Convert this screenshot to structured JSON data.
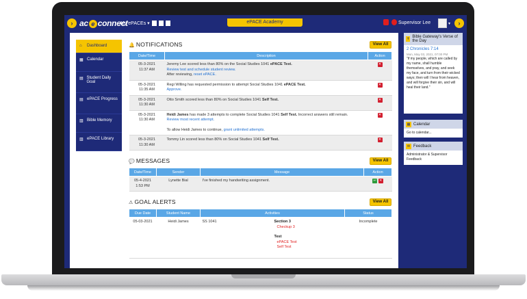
{
  "topbar": {
    "logo_text_pre": "ac",
    "logo_e": "e",
    "logo_text_post": "connect",
    "my_epaces": "My ePACEs",
    "academy_tab": "ePACE Academy",
    "user_name": "Supervisor Lee"
  },
  "sidebar": {
    "items": [
      {
        "label": "Dashboard",
        "icon": "home-icon"
      },
      {
        "label": "Calendar",
        "icon": "calendar-icon"
      },
      {
        "label": "Student Daily Goal",
        "icon": "goal-icon"
      },
      {
        "label": "ePACE Progress",
        "icon": "progress-icon"
      },
      {
        "label": "Bible Memory",
        "icon": "book-icon"
      },
      {
        "label": "ePACE Library",
        "icon": "library-icon"
      }
    ]
  },
  "notifications": {
    "title": "NOTIFICATIONS",
    "view_all": "View All",
    "headers": [
      "Date/Time",
      "Description",
      "Action"
    ],
    "rows": [
      {
        "date": "05-3-2021",
        "time": "11:37 AM",
        "name": "Jeremy Lee",
        "text": "scored less than 80% on the Social Studies 1041",
        "bold": "ePACE Test.",
        "link1": "Review test and schedule student review.",
        "line3_pre": "After reviewing,",
        "link2": "reset ePACE."
      },
      {
        "date": "05-3-2021",
        "time": "11:35 AM",
        "name": "Regi Willing",
        "text": "has requested permission to attempt Social Studies 1041",
        "bold": "ePACE Test.",
        "link1": "Approve."
      },
      {
        "date": "05-3-2021",
        "time": "11:30 AM",
        "name": "Otto Smith",
        "text": "scored less than 80% on Social Studies 1041",
        "bold": "Self Test."
      },
      {
        "date": "05-3-2021",
        "time": "11:30 AM",
        "name": "Heidi James",
        "text": "has made 3 attempts to complete Social Studies 1041",
        "bold": "Self Test.",
        "text2": "Incorrect answers still remain.",
        "link1": "Review most recent attempt.",
        "line3_pre": "To allow Heidi James to continue,",
        "link2": "grant unlimited attempts."
      },
      {
        "date": "05-3-2021",
        "time": "11:30 AM",
        "name": "Tommy Lin",
        "text": "scored less than 80% on Social Studies 1041",
        "bold": "Self Test."
      }
    ]
  },
  "messages": {
    "title": "MESSAGES",
    "view_all": "View All",
    "headers": [
      "Date/Time",
      "Sender",
      "Message",
      "Action"
    ],
    "rows": [
      {
        "date": "05-4-2021",
        "time": "1:53 PM",
        "sender": "Lynette Bial",
        "message": "I've finished my handwriting assignment."
      }
    ]
  },
  "goal_alerts": {
    "title": "GOAL ALERTS",
    "view_all": "View All",
    "headers": [
      "Due Date",
      "Student Name",
      "Activities",
      "Status"
    ],
    "rows": [
      {
        "due": "05-03-2021",
        "student": "Heidi James",
        "course": "SS 1041",
        "section": "Section 3",
        "checkup": "Checkup 3",
        "test": "Test",
        "test1": "ePACE Test",
        "test2": "Self Test",
        "status": "Incomplete"
      }
    ]
  },
  "right": {
    "verse_header": "Bible Gateway's Verse of the Day",
    "verse_ref": "2 Chronicles 7:14",
    "verse_date": "Mon, May 03, 2021, 07:00 PM",
    "verse_text": "\"if my people, which are called by my name, shall humble themselves, and pray, and seek my face, and turn from their wicked ways; then will I hear from heaven, and will forgive their sin, and will heal their land.\"",
    "calendar_header": "Calendar",
    "calendar_link": "Go to calendar...",
    "feedback_header": "Feedback",
    "feedback_link": "Administrator & Supervisor Feedback"
  },
  "colors": {
    "navy": "#1e2a78",
    "yellow": "#f5c400",
    "table_header": "#5aa7e6"
  }
}
